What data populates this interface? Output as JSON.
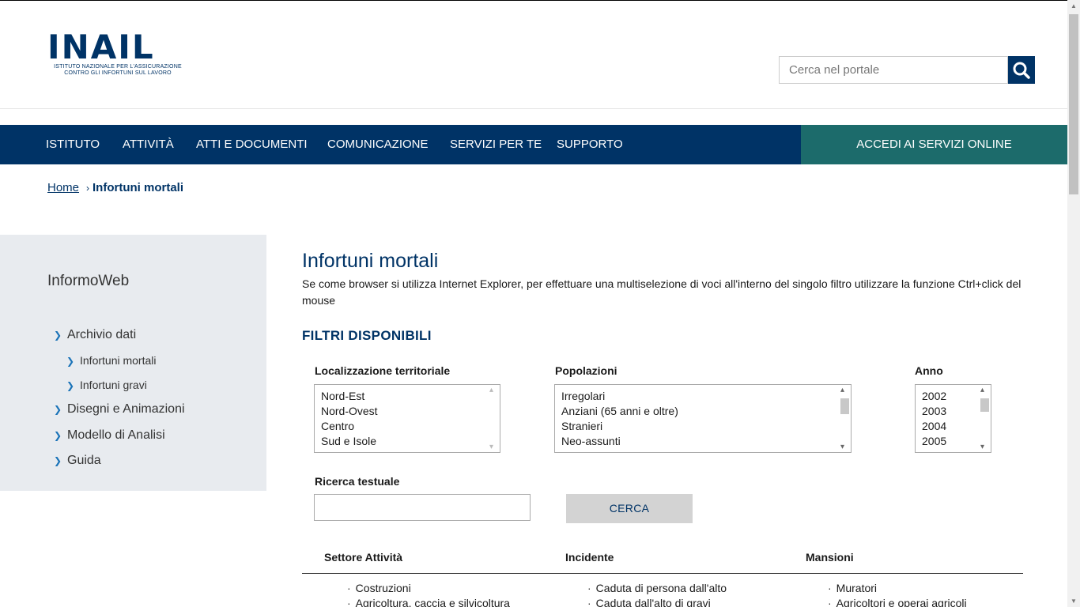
{
  "header": {
    "logo_text": "INAIL",
    "logo_subtitle_1": "ISTITUTO NAZIONALE PER L'ASSICURAZIONE",
    "logo_subtitle_2": "CONTRO GLI INFORTUNI SUL LAVORO",
    "search_placeholder": "Cerca nel portale",
    "search_icon": "magnifier-icon"
  },
  "nav": {
    "items": [
      "ISTITUTO",
      "ATTIVITÀ",
      "ATTI E DOCUMENTI",
      "COMUNICAZIONE",
      "SERVIZI PER TE",
      "SUPPORTO"
    ],
    "cta": "ACCEDI AI SERVIZI ONLINE"
  },
  "breadcrumb": {
    "home": "Home",
    "current": "Infortuni mortali"
  },
  "sidebar": {
    "title": "InformoWeb",
    "items": [
      {
        "label": "Archivio dati"
      },
      {
        "label": "Infortuni mortali"
      },
      {
        "label": "Infortuni gravi"
      },
      {
        "label": "Disegni e Animazioni"
      },
      {
        "label": "Modello di Analisi"
      },
      {
        "label": "Guida"
      }
    ]
  },
  "main": {
    "title": "Infortuni mortali",
    "description": "Se come browser si utilizza Internet Explorer, per effettuare una multiselezione di voci all'interno del singolo filtro utilizzare la funzione Ctrl+click del mouse",
    "filters_title": "FILTRI DISPONIBILI",
    "filters": {
      "localizzazione": {
        "label": "Localizzazione territoriale",
        "options": [
          "Nord-Est",
          "Nord-Ovest",
          "Centro",
          "Sud e Isole"
        ]
      },
      "popolazioni": {
        "label": "Popolazioni",
        "options": [
          "Irregolari",
          "Anziani (65 anni e oltre)",
          "Stranieri",
          "Neo-assunti"
        ]
      },
      "anno": {
        "label": "Anno",
        "options": [
          "2002",
          "2003",
          "2004",
          "2005"
        ]
      }
    },
    "text_search": {
      "label": "Ricerca testuale",
      "value": "",
      "button": "CERCA"
    },
    "columns": {
      "headers": [
        "Settore Attività",
        "Incidente",
        "Mansioni"
      ],
      "settore": [
        "Costruzioni",
        "Agricoltura, caccia e silvicoltura"
      ],
      "incidente": [
        "Caduta di persona dall'alto",
        "Caduta dall'alto di gravi"
      ],
      "mansioni": [
        "Muratori",
        "Agricoltori e operai agricoli"
      ]
    }
  },
  "colors": {
    "primary": "#003366",
    "cta": "#1c6b6b",
    "sidebar_bg": "#e8ebef"
  }
}
